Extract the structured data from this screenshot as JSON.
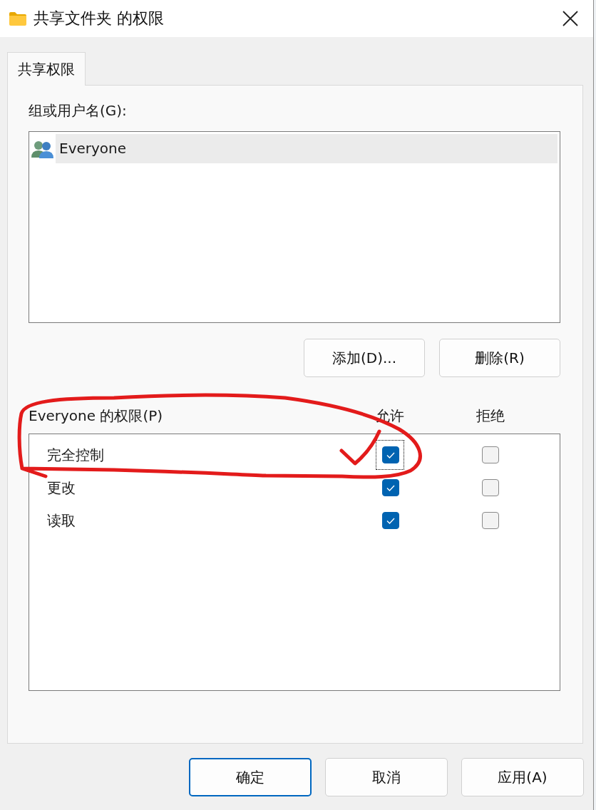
{
  "window": {
    "title": "共享文件夹 的权限"
  },
  "tabs": [
    {
      "label": "共享权限",
      "selected": true
    }
  ],
  "group_list": {
    "label": "组或用户名(G):",
    "items": [
      {
        "name": "Everyone",
        "selected": true
      }
    ]
  },
  "list_buttons": [
    "添加(D)...",
    "删除(R)"
  ],
  "permissions": {
    "label": "Everyone 的权限(P)",
    "columns": [
      "允许",
      "拒绝"
    ],
    "rows": [
      {
        "name": "完全控制",
        "allow": true,
        "deny": false,
        "focused": true
      },
      {
        "name": "更改",
        "allow": true,
        "deny": false,
        "focused": false
      },
      {
        "name": "读取",
        "allow": true,
        "deny": false,
        "focused": false
      }
    ]
  },
  "buttons": [
    {
      "label": "确定",
      "default": true
    },
    {
      "label": "取消",
      "default": false
    },
    {
      "label": "应用(A)",
      "default": false
    }
  ]
}
